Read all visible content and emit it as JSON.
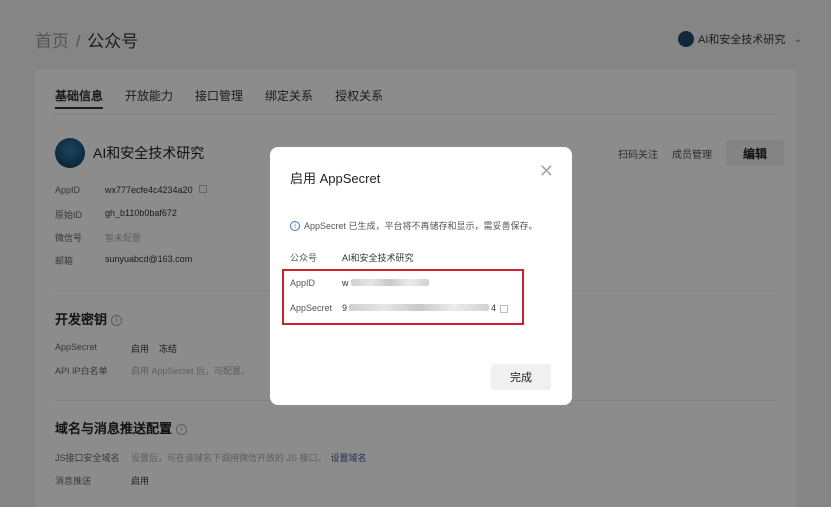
{
  "breadcrumb": {
    "home": "首页",
    "separator": "/",
    "current": "公众号"
  },
  "account_switch": {
    "name": "AI和安全技术研究",
    "icon": "chevron-down-icon"
  },
  "tabs": [
    "基础信息",
    "开放能力",
    "接口管理",
    "绑定关系",
    "授权关系"
  ],
  "account": {
    "name": "AI和安全技术研究",
    "actions": {
      "scan": "扫码关注",
      "members": "成员管理",
      "edit": "编辑"
    },
    "info": [
      {
        "k": "AppID",
        "v": "wx777ecfe4c4234a20"
      },
      {
        "k": "原始ID",
        "v": "gh_b110b0baf672"
      },
      {
        "k": "微信号",
        "v": "暂未配置"
      },
      {
        "k": "邮箱",
        "v": "sunyuabcd@163.com"
      }
    ]
  },
  "dev_key": {
    "title": "开发密钥",
    "appsecret_label": "AppSecret",
    "enable": "启用",
    "freeze": "冻结",
    "whitelist_label": "API IP白名单",
    "whitelist_value": "启用 AppSecret 后，可配置。"
  },
  "domain": {
    "title": "域名与消息推送配置",
    "js_label": "JS接口安全域名",
    "js_value": "设置后，可在该域名下调用微信开放的 JS 接口。",
    "js_link": "设置域名",
    "push_label": "消息推送",
    "push_value": "启用"
  },
  "modal": {
    "title": "启用 AppSecret",
    "close_icon": "close-icon",
    "notice": "AppSecret 已生成，平台将不再储存和显示，需妥善保存。",
    "account_label": "公众号",
    "account_value": "AI和安全技术研究",
    "appid_label": "AppID",
    "appid_value_prefix": "w",
    "appsecret_label": "AppSecret",
    "appsecret_value_prefix": "9",
    "appsecret_value_suffix": "4",
    "done": "完成"
  },
  "colors": {
    "highlight": "#d0202a",
    "overlay": "rgba(0,0,0,0.45)",
    "info": "#3a7ad0"
  }
}
